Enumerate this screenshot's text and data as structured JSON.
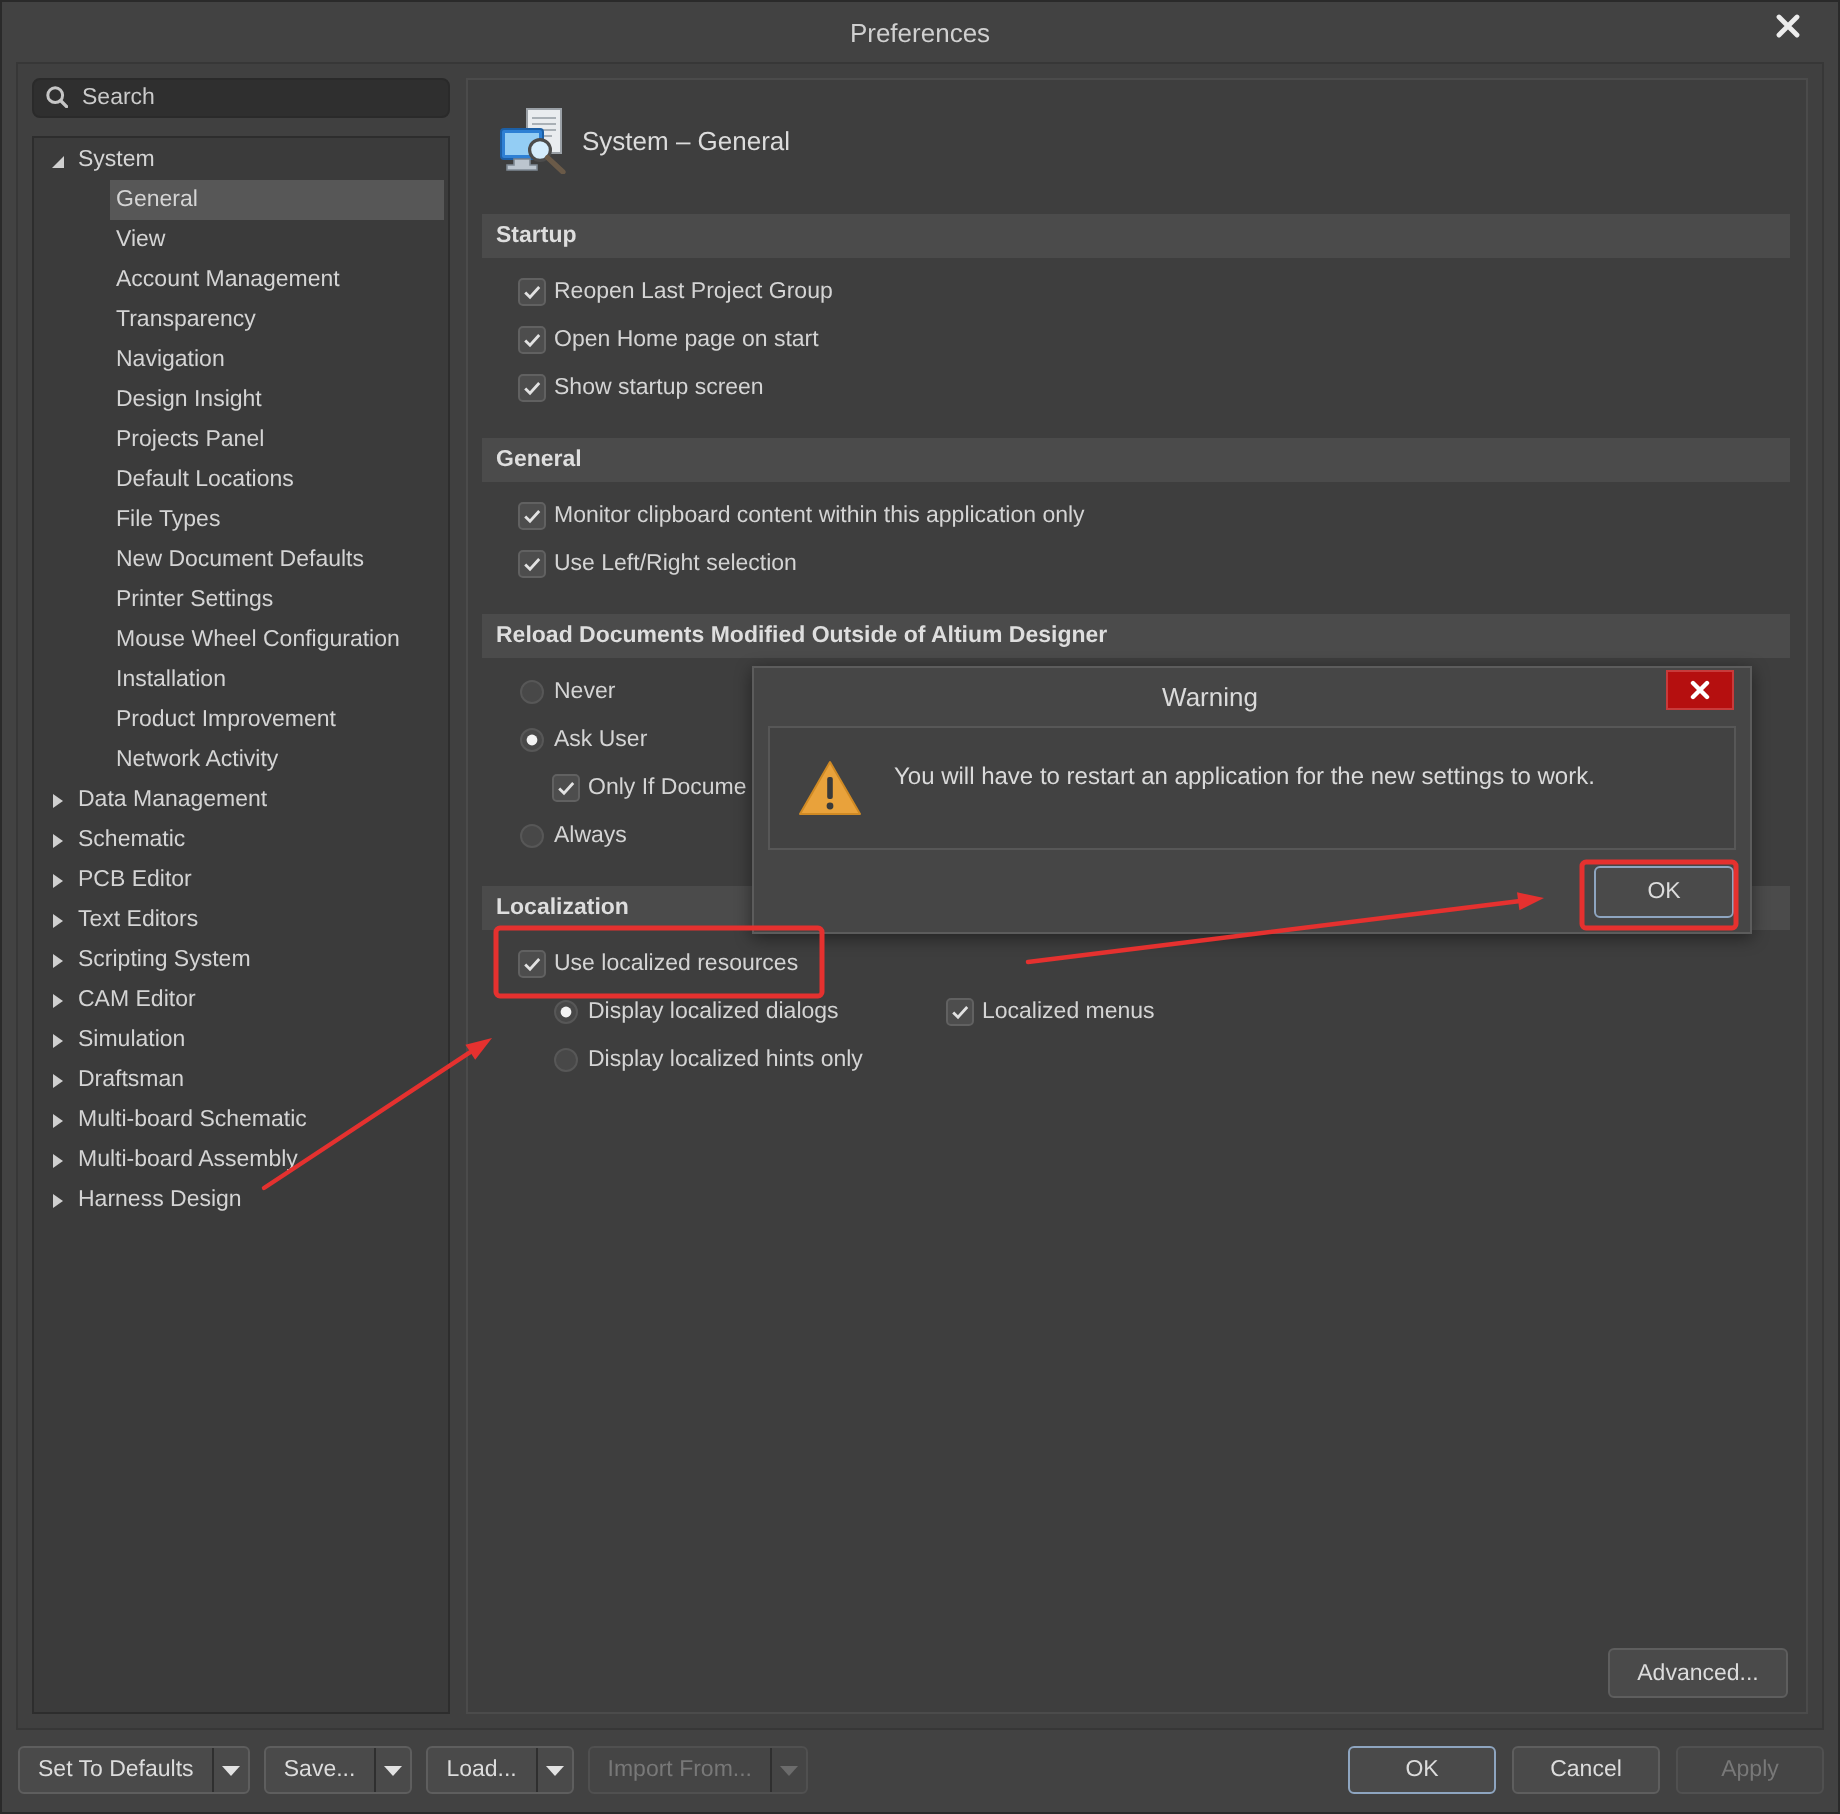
{
  "window": {
    "title": "Preferences"
  },
  "search": {
    "placeholder": "Search"
  },
  "tree": [
    {
      "label": "System",
      "expanded": true,
      "selected": false,
      "children": [
        {
          "label": "General",
          "selected": true
        },
        {
          "label": "View",
          "selected": false
        },
        {
          "label": "Account Management",
          "selected": false
        },
        {
          "label": "Transparency",
          "selected": false
        },
        {
          "label": "Navigation",
          "selected": false
        },
        {
          "label": "Design Insight",
          "selected": false
        },
        {
          "label": "Projects Panel",
          "selected": false
        },
        {
          "label": "Default Locations",
          "selected": false
        },
        {
          "label": "File Types",
          "selected": false
        },
        {
          "label": "New Document Defaults",
          "selected": false
        },
        {
          "label": "Printer Settings",
          "selected": false
        },
        {
          "label": "Mouse Wheel Configuration",
          "selected": false
        },
        {
          "label": "Installation",
          "selected": false
        },
        {
          "label": "Product Improvement",
          "selected": false
        },
        {
          "label": "Network Activity",
          "selected": false
        }
      ]
    },
    {
      "label": "Data Management",
      "expanded": false,
      "selected": false
    },
    {
      "label": "Schematic",
      "expanded": false,
      "selected": false
    },
    {
      "label": "PCB Editor",
      "expanded": false,
      "selected": false
    },
    {
      "label": "Text Editors",
      "expanded": false,
      "selected": false
    },
    {
      "label": "Scripting System",
      "expanded": false,
      "selected": false
    },
    {
      "label": "CAM Editor",
      "expanded": false,
      "selected": false
    },
    {
      "label": "Simulation",
      "expanded": false,
      "selected": false
    },
    {
      "label": "Draftsman",
      "expanded": false,
      "selected": false
    },
    {
      "label": "Multi-board Schematic",
      "expanded": false,
      "selected": false
    },
    {
      "label": "Multi-board Assembly",
      "expanded": false,
      "selected": false
    },
    {
      "label": "Harness Design",
      "expanded": false,
      "selected": false
    }
  ],
  "page": {
    "title": "System – General",
    "sections": [
      {
        "title": "Startup",
        "items": [
          {
            "kind": "checkbox",
            "label": "Reopen Last Project Group",
            "checked": true
          },
          {
            "kind": "checkbox",
            "label": "Open Home page on start",
            "checked": true
          },
          {
            "kind": "checkbox",
            "label": "Show startup screen",
            "checked": true
          }
        ]
      },
      {
        "title": "General",
        "items": [
          {
            "kind": "checkbox",
            "label": "Monitor clipboard content within this application only",
            "checked": true
          },
          {
            "kind": "checkbox",
            "label": "Use Left/Right selection",
            "checked": true
          }
        ]
      },
      {
        "title": "Reload Documents Modified Outside of Altium Designer",
        "items": [
          {
            "kind": "radio",
            "label": "Never",
            "selected": false
          },
          {
            "kind": "radio",
            "label": "Ask User",
            "selected": true,
            "children": [
              {
                "kind": "checkbox",
                "label": "Only If Docume",
                "checked": true
              }
            ]
          },
          {
            "kind": "radio",
            "label": "Always",
            "selected": false
          }
        ]
      },
      {
        "title": "Localization",
        "items": [
          {
            "kind": "checkbox",
            "label": "Use localized resources",
            "checked": true,
            "children": [
              {
                "kind": "radio",
                "label": "Display localized dialogs",
                "selected": true
              },
              {
                "kind": "checkbox",
                "label": "Localized menus",
                "checked": true
              },
              {
                "kind": "radio",
                "label": "Display localized hints only",
                "selected": false
              }
            ]
          }
        ]
      }
    ],
    "advanced_button": {
      "label": "Advanced..."
    }
  },
  "footer": {
    "left": [
      {
        "kind": "split",
        "label": "Set To Defaults",
        "disabled": false
      },
      {
        "kind": "split",
        "label": "Save...",
        "disabled": false
      },
      {
        "kind": "split",
        "label": "Load...",
        "disabled": false
      },
      {
        "kind": "split",
        "label": "Import From...",
        "disabled": true
      }
    ],
    "right": [
      {
        "kind": "plain",
        "label": "OK",
        "disabled": false,
        "focused": true
      },
      {
        "kind": "plain",
        "label": "Cancel",
        "disabled": false,
        "focused": false
      },
      {
        "kind": "plain",
        "label": "Apply",
        "disabled": true,
        "focused": false
      }
    ]
  },
  "dialog": {
    "title": "Warning",
    "message": "You will have to restart an application for the new settings to work.",
    "button": {
      "label": "OK",
      "focused": true
    }
  }
}
